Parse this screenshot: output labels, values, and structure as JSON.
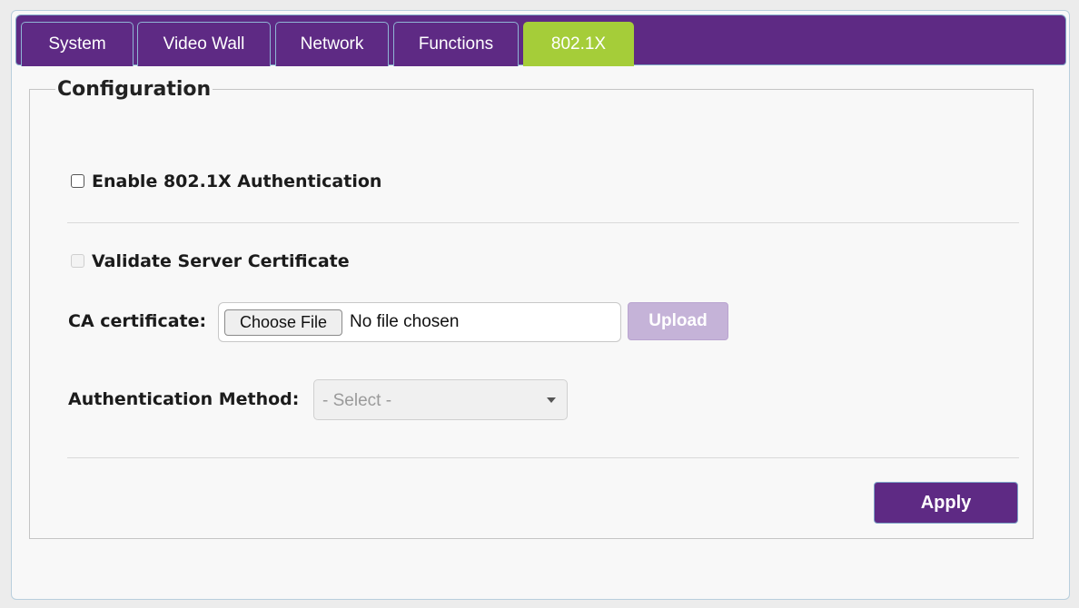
{
  "tabs": [
    {
      "label": "System",
      "active": false
    },
    {
      "label": "Video Wall",
      "active": false
    },
    {
      "label": "Network",
      "active": false
    },
    {
      "label": "Functions",
      "active": false
    },
    {
      "label": "802.1X",
      "active": true
    }
  ],
  "config": {
    "legend": "Configuration",
    "enable_auth": {
      "label": "Enable 802.1X Authentication",
      "checked": false,
      "disabled": false
    },
    "validate_cert": {
      "label": "Validate Server Certificate",
      "checked": false,
      "disabled": true
    },
    "ca_certificate": {
      "label": "CA certificate:",
      "choose_button": "Choose File",
      "file_status": "No file chosen",
      "upload_button": "Upload",
      "upload_disabled": true
    },
    "auth_method": {
      "label": "Authentication Method:",
      "selected": "- Select -",
      "disabled": true
    },
    "apply_button": "Apply"
  },
  "colors": {
    "brand_purple": "#5e2a84",
    "active_tab_green": "#a5cd39",
    "upload_disabled": "#c5b3d8"
  },
  "icons": [
    "checkbox",
    "dropdown-caret-icon"
  ]
}
